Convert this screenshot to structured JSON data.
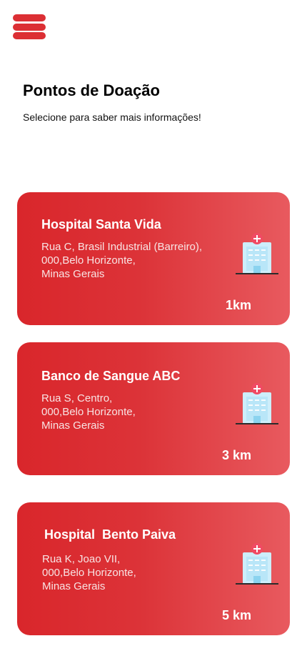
{
  "header": {
    "menu_icon": "hamburger-menu-icon",
    "accent_color": "#dc2f34"
  },
  "main": {
    "title": "Pontos de Doação",
    "subtitle": "Selecione para saber mais informações!"
  },
  "locations": [
    {
      "name": "Hospital Santa Vida",
      "address_lines": [
        "Rua C, Brasil Industrial (Barreiro),",
        "000,Belo Horizonte,",
        "Minas Gerais"
      ],
      "distance": "1km",
      "icon": "hospital-building-icon"
    },
    {
      "name": "Banco de Sangue ABC",
      "address_lines": [
        "Rua S, Centro,",
        "000,Belo Horizonte,",
        "Minas Gerais"
      ],
      "distance": "3 km",
      "icon": "hospital-building-icon"
    },
    {
      "name": "Hospital  Bento Paiva",
      "address_lines": [
        "Rua K, Joao VII,",
        "000,Belo Horizonte,",
        "Minas Gerais"
      ],
      "distance": "5 km",
      "icon": "hospital-building-icon"
    }
  ]
}
